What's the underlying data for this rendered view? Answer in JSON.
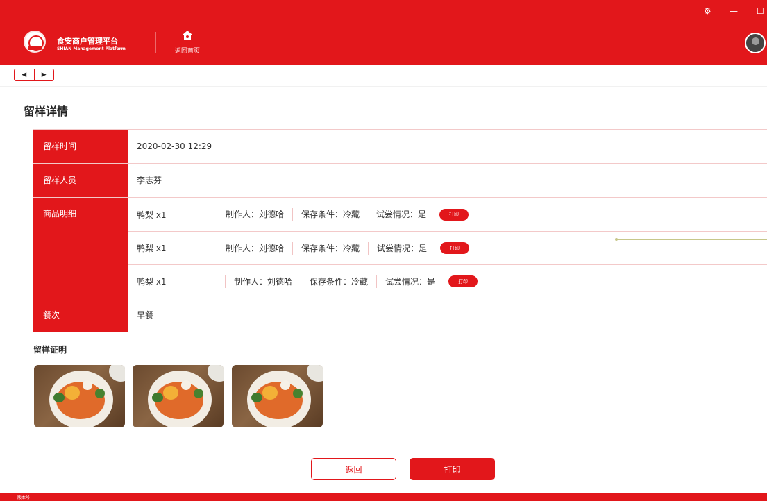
{
  "header": {
    "brand_cn": "食安商户管理平台",
    "brand_en": "SHIAN Management Platform",
    "home_label": "返回首页"
  },
  "page": {
    "title": "留样详情"
  },
  "details": {
    "sample_time_label": "留样时间",
    "sample_time": "2020-02-30 12:29",
    "sampler_label": "留样人员",
    "sampler": "李志芬",
    "goods_label": "商品明细",
    "goods": [
      {
        "name": "鸭梨 x1",
        "maker": "制作人：刘德哈",
        "storage": "保存条件：冷藏",
        "taste": "试尝情况：是",
        "print": "打印"
      },
      {
        "name": "鸭梨 x1",
        "maker": "制作人：刘德哈",
        "storage": "保存条件：冷藏",
        "taste": "试尝情况：是",
        "print": "打印"
      },
      {
        "name": "鸭梨 x1",
        "maker": "制作人：刘德哈",
        "storage": "保存条件：冷藏",
        "taste": "试尝情况：是",
        "print": "打印"
      }
    ],
    "meal_label": "餐次",
    "meal": "早餐"
  },
  "proof": {
    "title": "留样证明"
  },
  "actions": {
    "back": "返回",
    "print": "打印"
  },
  "footer": {
    "text": "版本号"
  },
  "colors": {
    "brand_red": "#e2171b"
  },
  "icons": [
    "settings-icon",
    "minimize-icon",
    "maximize-icon",
    "home-icon",
    "chevron-left-icon",
    "chevron-right-icon"
  ]
}
